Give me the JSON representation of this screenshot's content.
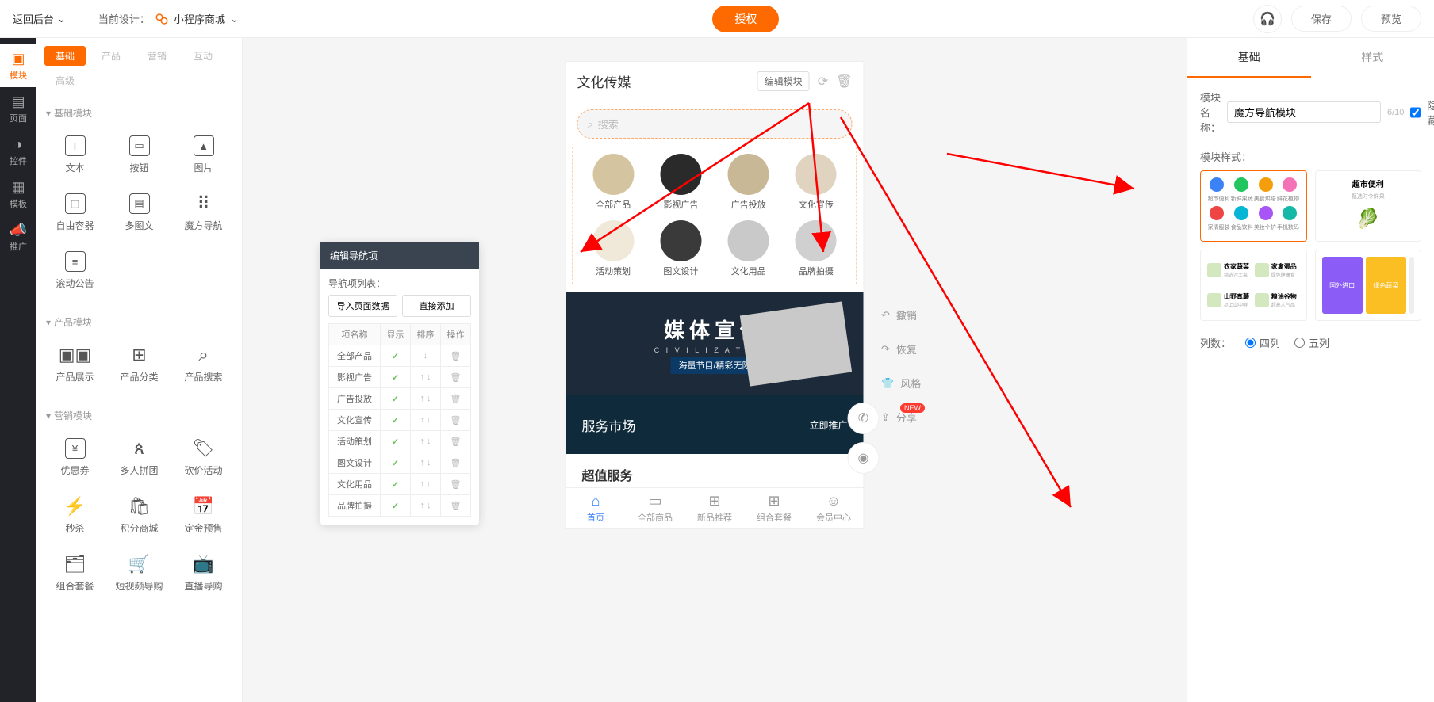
{
  "topbar": {
    "back": "返回后台",
    "current_design_label": "当前设计：",
    "design_name": "小程序商城",
    "auth": "授权",
    "save": "保存",
    "preview": "预览"
  },
  "rail": [
    {
      "label": "模块",
      "active": true
    },
    {
      "label": "页面"
    },
    {
      "label": "控件"
    },
    {
      "label": "模板"
    },
    {
      "label": "推广"
    }
  ],
  "module_tabs": {
    "main": [
      "基础",
      "产品",
      "营销",
      "互动"
    ],
    "sub": [
      "高级"
    ],
    "active": "基础"
  },
  "sections": {
    "basic": {
      "title": "基础模块",
      "items": [
        "文本",
        "按钮",
        "图片",
        "自由容器",
        "多图文",
        "魔方导航",
        "滚动公告"
      ]
    },
    "product": {
      "title": "产品模块",
      "items": [
        "产品展示",
        "产品分类",
        "产品搜索"
      ]
    },
    "marketing": {
      "title": "营销模块",
      "items": [
        "优惠券",
        "多人拼团",
        "砍价活动",
        "秒杀",
        "积分商城",
        "定金预售",
        "组合套餐",
        "短视频导购",
        "直播导购"
      ]
    }
  },
  "preview": {
    "title": "文化传媒",
    "edit_module": "编辑模块",
    "search_placeholder": "搜索",
    "nav_items": [
      "全部产品",
      "影视广告",
      "广告投放",
      "文化宣传",
      "活动策划",
      "图文设计",
      "文化用品",
      "品牌拍摄"
    ],
    "banner1": {
      "title": "媒体宣传",
      "sub1": "C I V I L I Z A T I O N",
      "sub2": "海量节目/精彩无限"
    },
    "banner2": {
      "title": "服务市场",
      "cta": "立即推广"
    },
    "banner3": "超值服务",
    "tabs": [
      "首页",
      "全部商品",
      "新品推荐",
      "组合套餐",
      "会员中心"
    ]
  },
  "canvas_actions": {
    "undo": "撤销",
    "redo": "恢复",
    "style": "风格",
    "share": "分享",
    "share_badge": "NEW"
  },
  "nav_editor": {
    "title": "编辑导航项",
    "list_label": "导航项列表：",
    "import_btn": "导入页面数据",
    "add_btn": "直接添加",
    "columns": [
      "项名称",
      "显示",
      "排序",
      "操作"
    ],
    "rows": [
      "全部产品",
      "影视广告",
      "广告投放",
      "文化宣传",
      "活动策划",
      "图文设计",
      "文化用品",
      "品牌拍摄"
    ]
  },
  "right": {
    "tabs": {
      "basic": "基础",
      "style": "样式"
    },
    "name_label": "模块名称：",
    "name_value": "魔方导航模块",
    "name_counter": "6/10",
    "hide": "隐藏",
    "style_label": "模块样式：",
    "style2_title": "超市便利",
    "style2_sub": "甄选时令鲜果",
    "style3_items": [
      {
        "t": "农家蔬菜",
        "s": "精选污土菜"
      },
      {
        "t": "家禽蛋品",
        "s": "绿色健康食"
      },
      {
        "t": "山野真蘑",
        "s": "尽上山中鲜"
      },
      {
        "t": "粮油谷物",
        "s": "超高人气品"
      }
    ],
    "cols_label": "列数：",
    "cols4": "四列",
    "cols5": "五列"
  }
}
